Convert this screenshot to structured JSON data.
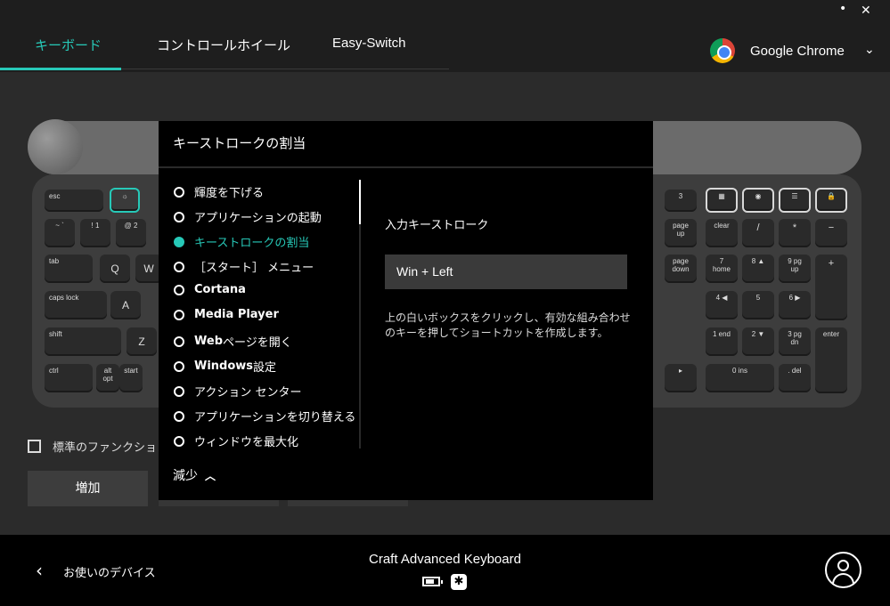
{
  "window": {
    "minimize": "•",
    "close": "✕"
  },
  "tabs": [
    {
      "label": "キーボード"
    },
    {
      "label": "コントロールホイール"
    },
    {
      "label": "Easy-Switch"
    }
  ],
  "app_selector": {
    "name": "Google Chrome",
    "icon": "chrome-icon"
  },
  "keyboard": {
    "keys": {
      "esc": "esc",
      "tab": "tab",
      "caps": "caps lock",
      "shift": "shift",
      "ctrl": "ctrl",
      "alt": "alt opt",
      "start": "start",
      "q": "Q",
      "w": "W",
      "a": "A",
      "z": "Z",
      "k1": "! 1",
      "k2": "@ 2",
      "tilde": "~ `",
      "three": "3",
      "pageup": "page up",
      "pagedown": "page down",
      "clear": "clear",
      "div": "/",
      "mul": "*",
      "minus": "−",
      "n7": "7 home",
      "n8": "8 ▲",
      "n9": "9 pg up",
      "plus": "+",
      "n4": "4 ◀",
      "n5": "5",
      "n6": "6 ▶",
      "n1": "1 end",
      "n2": "2 ▼",
      "n3": "3 pg dn",
      "enter": "enter",
      "n0": "0 ins",
      "dot": ". del",
      "eq": "=",
      "right": "▸"
    }
  },
  "fn_checkbox_label": "標準のファンクションキ",
  "add_button": "増加",
  "popup": {
    "title": "キーストロークの割当",
    "options": [
      {
        "label": "輝度を下げる"
      },
      {
        "label": "アプリケーションの起動"
      },
      {
        "label": "キーストロークの割当"
      },
      {
        "label": "［スタート］ メニュー"
      },
      {
        "label": "Cortana"
      },
      {
        "label": "Media Player"
      },
      {
        "label_bold": "Web",
        "label": " ページを開く"
      },
      {
        "label_bold": "Windows",
        "label": " 設定"
      },
      {
        "label": "アクション センター"
      },
      {
        "label": "アプリケーションを切り替える"
      },
      {
        "label": "ウィンドウを最大化"
      }
    ],
    "less_label": "減少",
    "input_label": "入力キーストローク",
    "keystroke_value": "Win + Left",
    "hint": "上の白いボックスをクリックし、有効な組み合わせのキーを押してショートカットを作成します。"
  },
  "footer": {
    "back_label": "お使いのデバイス",
    "device_name": "Craft Advanced Keyboard"
  },
  "colors": {
    "accent": "#27c9b8",
    "background": "#2b2b2b",
    "popup": "#000000"
  }
}
